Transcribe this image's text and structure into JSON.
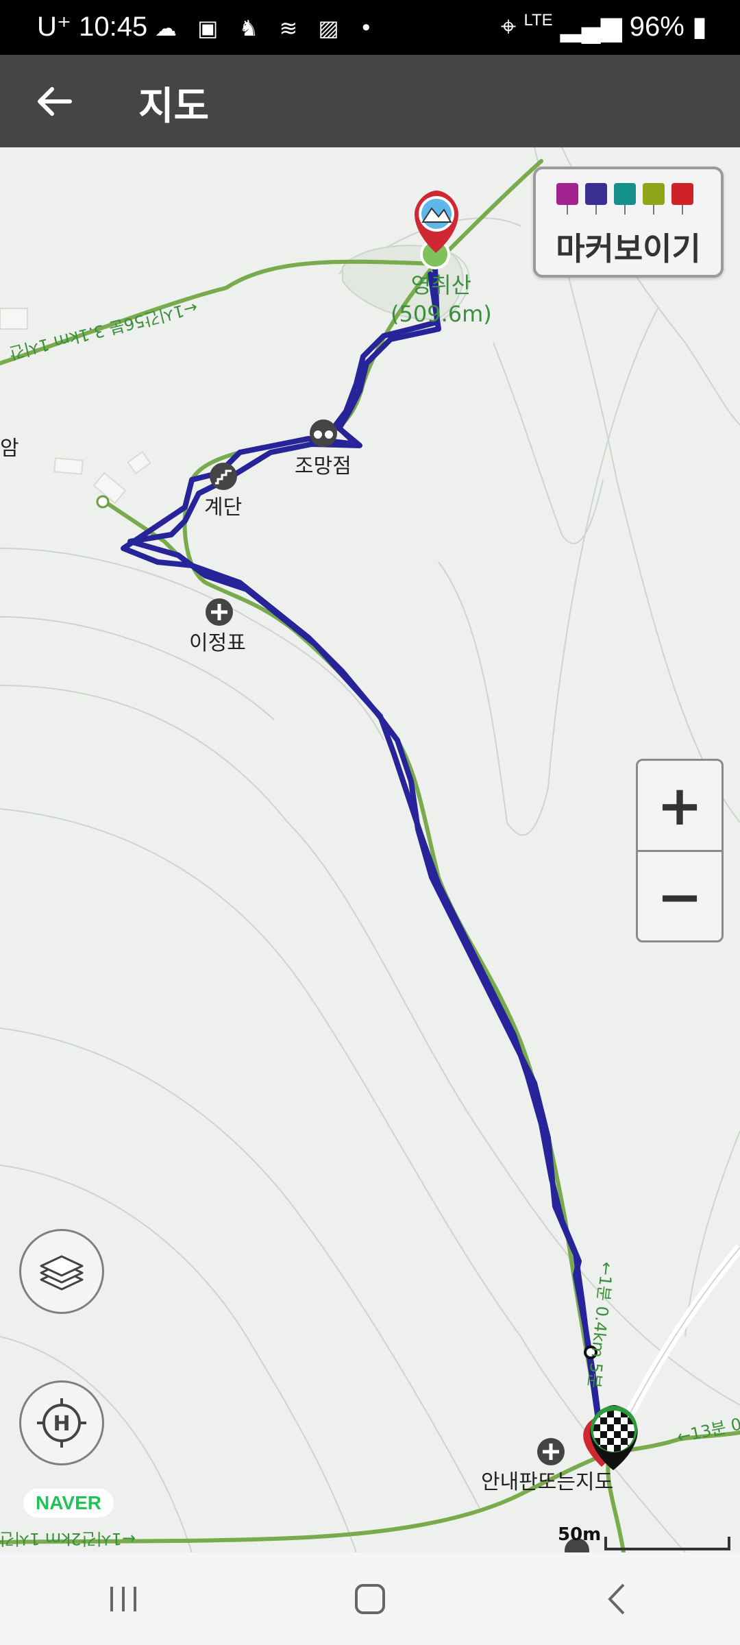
{
  "status_bar": {
    "carrier": "U⁺",
    "time": "10:45",
    "app_icons": [
      "cloud-icon",
      "app-icon",
      "runner-icon",
      "stack-icon",
      "image-icon",
      "dot-icon"
    ],
    "location_icon": "location-pin-icon",
    "network": "LTE",
    "battery": "96%"
  },
  "app_bar": {
    "back_icon": "arrow-left-icon",
    "title": "지도"
  },
  "map": {
    "peak": {
      "name": "영취산",
      "elevation": "(509.6m)"
    },
    "labels": {
      "observatory": "조망점",
      "stairs": "계단",
      "milestone": "이정표",
      "guide_map": "안내판또는지도",
      "edge_text": "암"
    },
    "trail_texts": {
      "left_upper": "←1시간56분 3.1km 1시간",
      "right_vertical": "←1분 0.4km 5분",
      "right_edge": "←13분 0",
      "bottom_left": "←1시간2km 1시간"
    },
    "marker_panel": {
      "label": "마커보이기",
      "flags": [
        {
          "icon": "camera-icon",
          "color": "#a2238f"
        },
        {
          "icon": "video-icon",
          "color": "#3a2f93"
        },
        {
          "icon": "pen-icon",
          "color": "#15908a"
        },
        {
          "icon": "note-icon",
          "color": "#8fa51a"
        },
        {
          "icon": "flag-icon",
          "color": "#cf2128"
        }
      ]
    },
    "zoom": {
      "in_label": "+",
      "out_label": "−"
    },
    "layers_icon": "layers-icon",
    "home_icon": "home-target-icon",
    "logo": "NAVER",
    "scale": "50m",
    "colors": {
      "trail": "#7aaa4e",
      "track": "#27249a",
      "contour": "#c9cdc8"
    }
  },
  "nav_bar": {
    "buttons": [
      "recent-apps-icon",
      "home-icon",
      "back-icon"
    ]
  }
}
